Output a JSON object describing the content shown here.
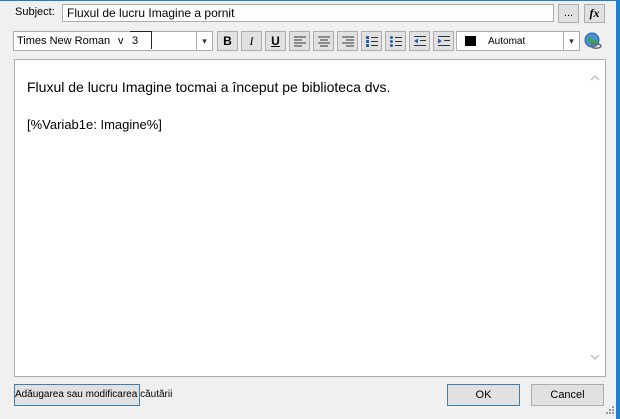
{
  "subject": {
    "label": "Subject:",
    "value": "Fluxul de lucru Imagine a pornit",
    "browse_label": "...",
    "formula_label": "fx"
  },
  "toolbar": {
    "font_name": "Times New Roman",
    "font_size_arrow": "v",
    "font_size": "3",
    "color_label": "Automat",
    "color_value": "#000000",
    "dropdown_arrow": "▾"
  },
  "editor": {
    "line1": "Fluxul de lucru Imagine tocmai a început pe biblioteca dvs.",
    "line2": "[%Variab1e: Imagine%]",
    "scroll_up": "^",
    "scroll_down": "v"
  },
  "footer": {
    "add_lookup": "Adăugarea sau modificarea căutării",
    "ok": "OK",
    "cancel": "Cancel"
  },
  "icons": [
    "bold-icon",
    "italic-icon",
    "underline-icon",
    "align-left-icon",
    "align-center-icon",
    "align-right-icon",
    "numbered-list-icon",
    "bullet-list-icon",
    "decrease-indent-icon",
    "increase-indent-icon",
    "globe-link-icon"
  ]
}
